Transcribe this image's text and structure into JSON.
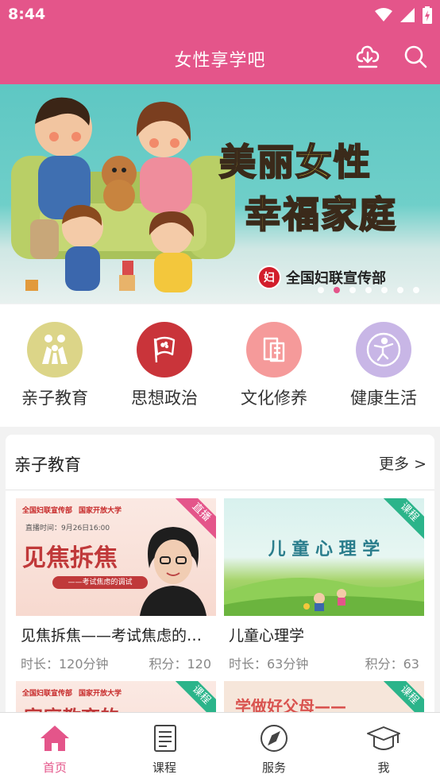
{
  "status": {
    "time": "8:44"
  },
  "app": {
    "title": "女性享学吧",
    "accent": "#e4558a"
  },
  "icons": {
    "download": "download-icon",
    "search": "search-icon"
  },
  "banner": {
    "headline1": "美丽女性",
    "headline2": "幸福家庭",
    "org": "全国妇联宣传部",
    "slide_count": 7,
    "active_slide": 2
  },
  "categories": [
    {
      "label": "亲子教育",
      "color": "#dcd588",
      "icon": "family-icon"
    },
    {
      "label": "思想政治",
      "color": "#c9343a",
      "icon": "flag-icon"
    },
    {
      "label": "文化修养",
      "color": "#f59a9a",
      "icon": "book-icon"
    },
    {
      "label": "健康生活",
      "color": "#c8b6e6",
      "icon": "exercise-icon"
    }
  ],
  "section": {
    "title": "亲子教育",
    "more": "更多 >"
  },
  "courses": [
    {
      "title": "见焦拆焦——考试焦虑的调试",
      "badge": "直播",
      "badge_color": "#e4558a",
      "duration": "时长：120分钟",
      "points": "积分：120",
      "thumb_title": "见焦拆焦",
      "thumb_sub": "——考试焦虑的调试",
      "thumb_live": "直播时间：9月26日16:00",
      "thumb_orgs": [
        "全国妇联宣传部",
        "国家开放大学"
      ]
    },
    {
      "title": "儿童心理学",
      "badge": "课程",
      "badge_color": "#2bb48a",
      "duration": "时长：63分钟",
      "points": "积分：63",
      "thumb_title": "儿 童 心 理 学"
    },
    {
      "badge": "课程",
      "badge_color": "#2bb48a",
      "thumb_title": "家庭教育的",
      "thumb_orgs": [
        "全国妇联宣传部",
        "国家开放大学"
      ]
    },
    {
      "badge": "课程",
      "badge_color": "#2bb48a",
      "thumb_title": "学做好父母——"
    }
  ],
  "nav": [
    {
      "label": "首页",
      "icon": "home-icon",
      "active": true
    },
    {
      "label": "课程",
      "icon": "course-list-icon",
      "active": false
    },
    {
      "label": "服务",
      "icon": "compass-icon",
      "active": false
    },
    {
      "label": "我",
      "icon": "graduation-cap-icon",
      "active": false
    }
  ]
}
